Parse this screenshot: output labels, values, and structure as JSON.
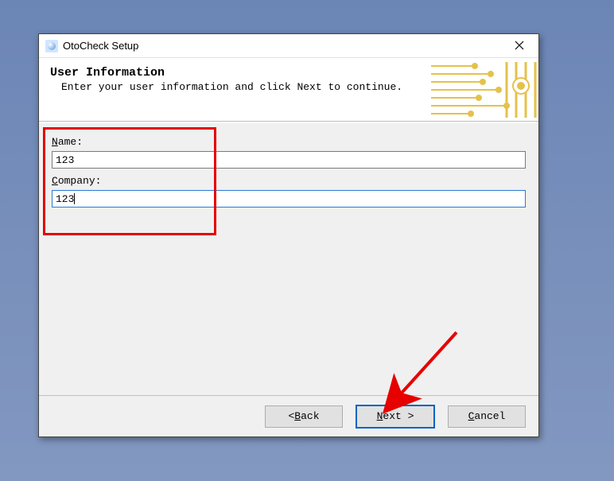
{
  "window": {
    "title": "OtoCheck Setup"
  },
  "header": {
    "heading": "User Information",
    "subtext": "Enter your user information and click Next to continue."
  },
  "form": {
    "name_label_pre": "N",
    "name_label_post": "ame:",
    "name_value": "123",
    "company_label_pre": "C",
    "company_label_post": "ompany:",
    "company_value": "123"
  },
  "buttons": {
    "back_pre": "< ",
    "back_ul": "B",
    "back_post": "ack",
    "next_ul": "N",
    "next_post": "ext >",
    "cancel_ul": "C",
    "cancel_post": "ancel"
  }
}
